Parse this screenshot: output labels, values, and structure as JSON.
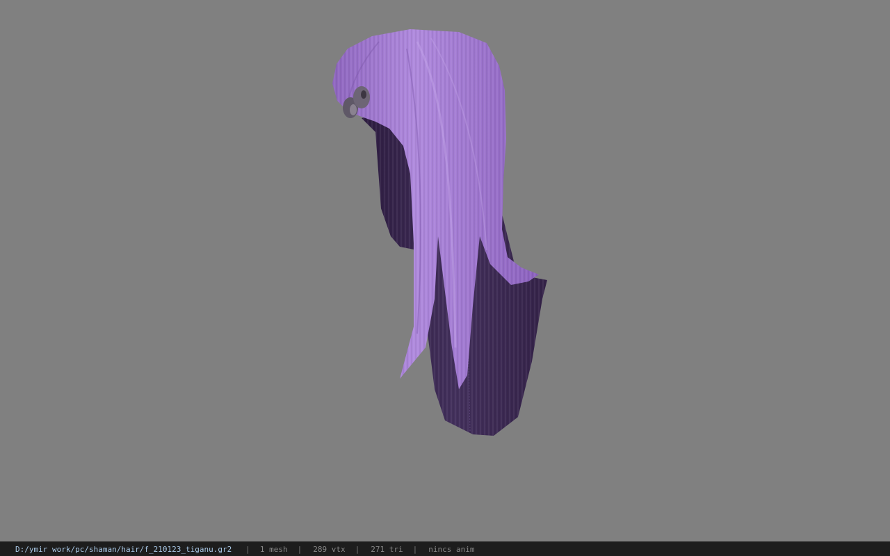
{
  "viewport": {
    "background": "#808080",
    "model": "purple long hair mesh",
    "hair_colors": {
      "light": "#a07ad0",
      "mid": "#8a64bb",
      "dark": "#3a2550",
      "clip": "#6b6470"
    }
  },
  "status_bar": {
    "file_path": "D:/ymir work/pc/shaman/hair/f_210123_tiganu.gr2",
    "separator": "|",
    "mesh_count": "1 mesh",
    "vertex_count": "289 vtx",
    "triangle_count": "271 tri",
    "animation": "nincs anim"
  }
}
